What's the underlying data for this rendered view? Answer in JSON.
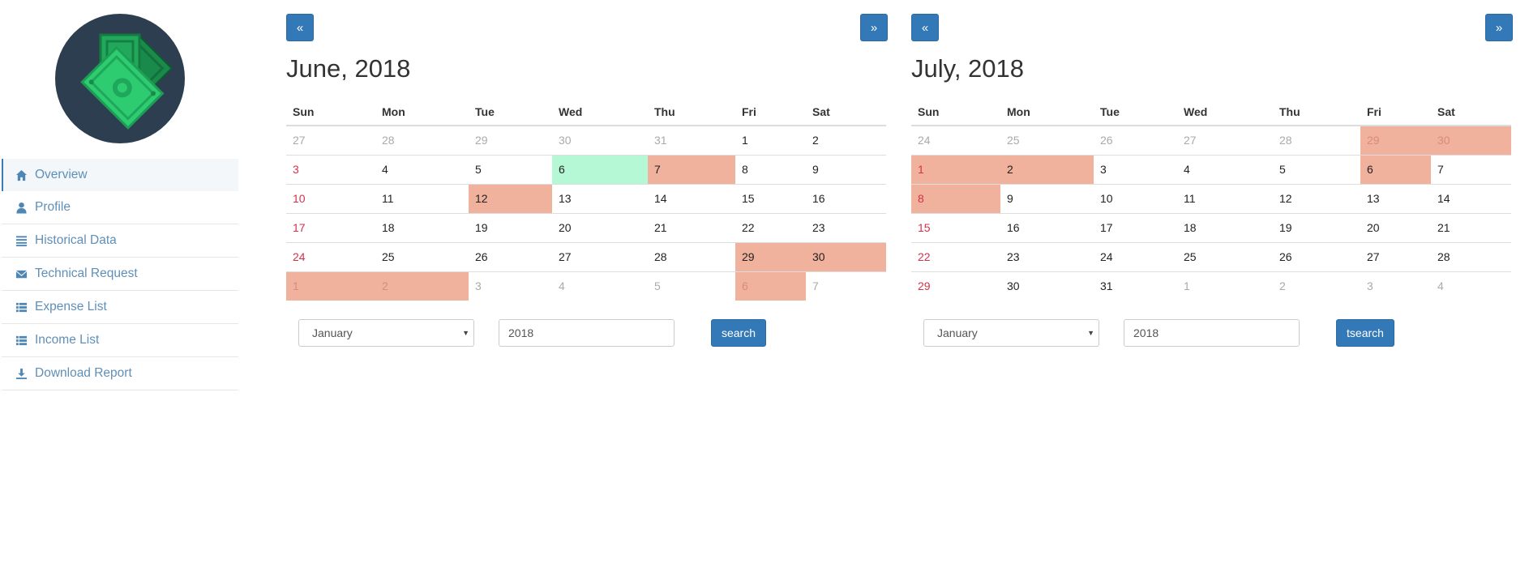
{
  "sidebar": {
    "items": [
      {
        "label": "Overview",
        "icon": "home-icon",
        "active": true
      },
      {
        "label": "Profile",
        "icon": "user-icon"
      },
      {
        "label": "Historical Data",
        "icon": "list-lines-icon"
      },
      {
        "label": "Technical Request",
        "icon": "envelope-icon"
      },
      {
        "label": "Expense List",
        "icon": "list-icon"
      },
      {
        "label": "Income List",
        "icon": "list-icon"
      },
      {
        "label": "Download Report",
        "icon": "download-icon"
      }
    ]
  },
  "colors": {
    "primary": "#3379b7",
    "highlight_red": "#f0b19d",
    "highlight_green": "#b4f8d6",
    "sunday_red": "#d2334a",
    "nav_link": "#5f8fb8"
  },
  "weekdays": [
    "Sun",
    "Mon",
    "Tue",
    "Wed",
    "Thu",
    "Fri",
    "Sat"
  ],
  "calendars": [
    {
      "prev_label": "«",
      "next_label": "»",
      "title": "June, 2018",
      "weeks": [
        [
          {
            "d": "27",
            "m": 1
          },
          {
            "d": "28",
            "m": 1
          },
          {
            "d": "29",
            "m": 1
          },
          {
            "d": "30",
            "m": 1
          },
          {
            "d": "31",
            "m": 1
          },
          {
            "d": "1"
          },
          {
            "d": "2"
          }
        ],
        [
          {
            "d": "3"
          },
          {
            "d": "4"
          },
          {
            "d": "5"
          },
          {
            "d": "6",
            "h": "green"
          },
          {
            "d": "7",
            "h": "red"
          },
          {
            "d": "8"
          },
          {
            "d": "9"
          }
        ],
        [
          {
            "d": "10"
          },
          {
            "d": "11"
          },
          {
            "d": "12",
            "h": "red"
          },
          {
            "d": "13"
          },
          {
            "d": "14"
          },
          {
            "d": "15"
          },
          {
            "d": "16"
          }
        ],
        [
          {
            "d": "17"
          },
          {
            "d": "18"
          },
          {
            "d": "19"
          },
          {
            "d": "20"
          },
          {
            "d": "21"
          },
          {
            "d": "22"
          },
          {
            "d": "23"
          }
        ],
        [
          {
            "d": "24"
          },
          {
            "d": "25"
          },
          {
            "d": "26"
          },
          {
            "d": "27"
          },
          {
            "d": "28"
          },
          {
            "d": "29",
            "h": "red"
          },
          {
            "d": "30",
            "h": "red"
          }
        ],
        [
          {
            "d": "1",
            "m": 1,
            "h": "red"
          },
          {
            "d": "2",
            "m": 1,
            "h": "red"
          },
          {
            "d": "3",
            "m": 1
          },
          {
            "d": "4",
            "m": 1
          },
          {
            "d": "5",
            "m": 1
          },
          {
            "d": "6",
            "m": 1,
            "h": "red"
          },
          {
            "d": "7",
            "m": 1
          }
        ]
      ],
      "month_select": "January",
      "year_value": "2018",
      "search_label": "search"
    },
    {
      "prev_label": "«",
      "next_label": "»",
      "title": "July, 2018",
      "weeks": [
        [
          {
            "d": "24",
            "m": 1
          },
          {
            "d": "25",
            "m": 1
          },
          {
            "d": "26",
            "m": 1
          },
          {
            "d": "27",
            "m": 1
          },
          {
            "d": "28",
            "m": 1
          },
          {
            "d": "29",
            "m": 1,
            "h": "red"
          },
          {
            "d": "30",
            "m": 1,
            "h": "red"
          }
        ],
        [
          {
            "d": "1",
            "h": "red"
          },
          {
            "d": "2",
            "h": "red"
          },
          {
            "d": "3"
          },
          {
            "d": "4"
          },
          {
            "d": "5"
          },
          {
            "d": "6",
            "h": "red"
          },
          {
            "d": "7"
          }
        ],
        [
          {
            "d": "8",
            "h": "red"
          },
          {
            "d": "9"
          },
          {
            "d": "10"
          },
          {
            "d": "11"
          },
          {
            "d": "12"
          },
          {
            "d": "13"
          },
          {
            "d": "14"
          }
        ],
        [
          {
            "d": "15"
          },
          {
            "d": "16"
          },
          {
            "d": "17"
          },
          {
            "d": "18"
          },
          {
            "d": "19"
          },
          {
            "d": "20"
          },
          {
            "d": "21"
          }
        ],
        [
          {
            "d": "22"
          },
          {
            "d": "23"
          },
          {
            "d": "24"
          },
          {
            "d": "25"
          },
          {
            "d": "26"
          },
          {
            "d": "27"
          },
          {
            "d": "28"
          }
        ],
        [
          {
            "d": "29"
          },
          {
            "d": "30"
          },
          {
            "d": "31"
          },
          {
            "d": "1",
            "m": 1
          },
          {
            "d": "2",
            "m": 1
          },
          {
            "d": "3",
            "m": 1
          },
          {
            "d": "4",
            "m": 1
          }
        ]
      ],
      "month_select": "January",
      "year_value": "2018",
      "search_label": "tsearch"
    }
  ]
}
